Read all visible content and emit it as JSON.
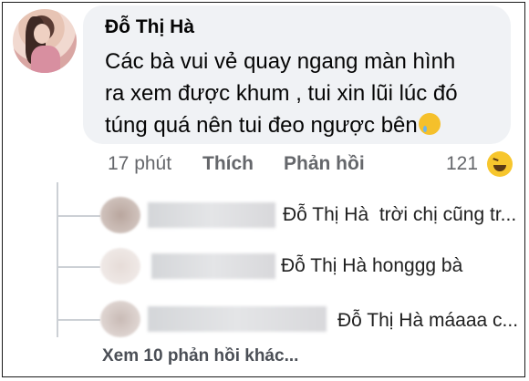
{
  "comment": {
    "author": "Đỗ Thị Hà",
    "lines": [
      "Các bà vui vẻ quay ngang màn hình",
      "ra xem được khum , tui xin lũi lúc đó",
      "túng quá nên tui đeo ngược bên"
    ],
    "emoji_icon": "tear-smile-emoji-icon"
  },
  "actions": {
    "time": "17 phút",
    "like": "Thích",
    "reply": "Phản hồi",
    "reaction_count": "121",
    "reaction_icon": "haha-reaction-icon"
  },
  "replies": [
    {
      "mention": "Đỗ Thị Hà",
      "text": "trời chị cũng tr..."
    },
    {
      "mention": "Đỗ Thị Hà",
      "text": "honggg bà"
    },
    {
      "mention": "Đỗ Thị Hà",
      "text": "máaaa c..."
    }
  ],
  "more_replies": "Xem 10 phản hồi khác..."
}
